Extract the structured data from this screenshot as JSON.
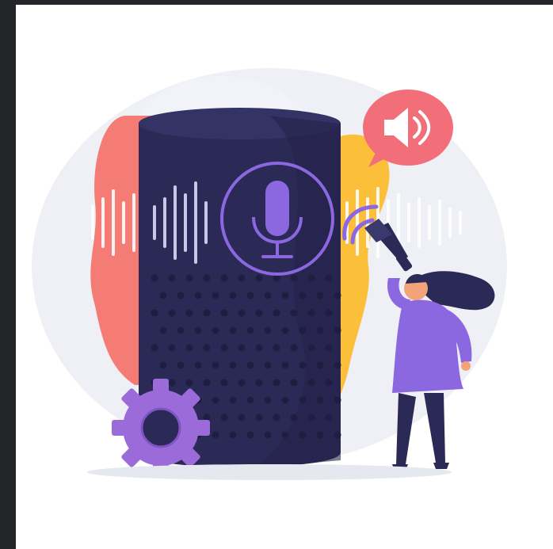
{
  "image": {
    "subject": "voice-assistant-illustration",
    "colors": {
      "background_frame": "#232529",
      "canvas": "#ffffff",
      "speaker_body": "#2b2a57",
      "accent_purple": "#8b67e0",
      "blob_coral": "#f47c74",
      "blob_yellow": "#fbbf3a",
      "sound_bubble": "#f26f7a"
    }
  }
}
